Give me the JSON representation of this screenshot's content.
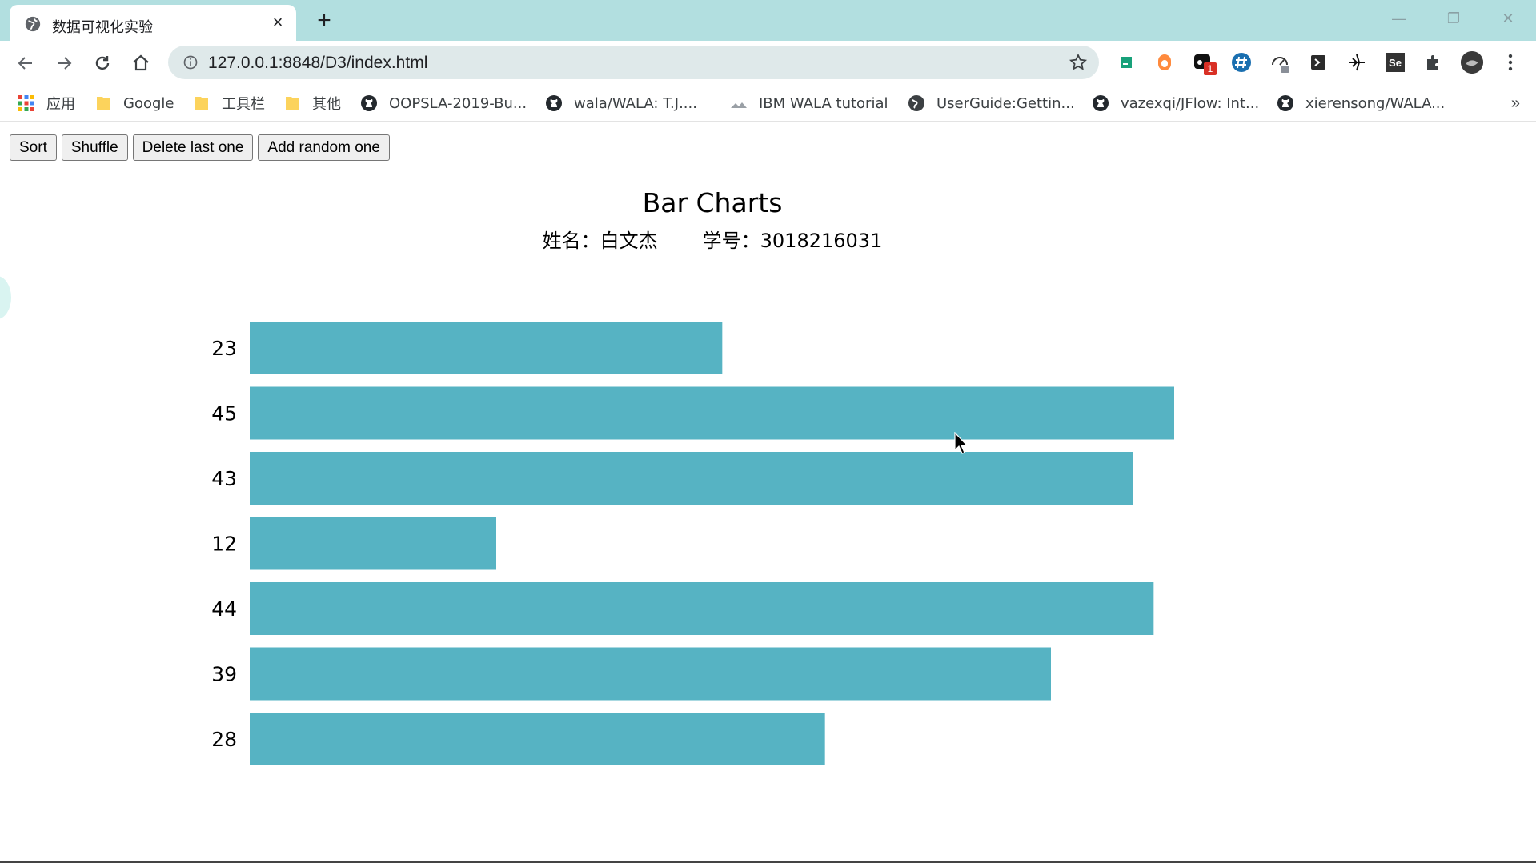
{
  "browser": {
    "tab": {
      "title": "数据可视化实验",
      "close_icon": "×"
    },
    "new_tab_label": "+",
    "window_controls": {
      "minimize": "—",
      "restore": "❐",
      "close": "✕"
    },
    "address": {
      "url": "127.0.0.1:8848/D3/index.html"
    },
    "extensions": [
      "jetbrains-icon",
      "firefox-style-icon",
      "notion-icon",
      "hash-icon",
      "speed-icon",
      "terminal-icon",
      "plane-icon",
      "selenium-icon",
      "puzzle-icon",
      "profile-avatar"
    ],
    "extension_badge": "1",
    "selenium_label": "Se",
    "bookmarks": [
      {
        "label": "应用",
        "icon": "apps-grid-icon"
      },
      {
        "label": "Google",
        "icon": "folder-icon"
      },
      {
        "label": "工具栏",
        "icon": "folder-icon"
      },
      {
        "label": "其他",
        "icon": "folder-icon"
      },
      {
        "label": "OOPSLA-2019-Bu...",
        "icon": "github-icon"
      },
      {
        "label": "wala/WALA: T.J....",
        "icon": "github-icon"
      },
      {
        "label": "IBM WALA tutorial",
        "icon": "mountain-icon"
      },
      {
        "label": "UserGuide:Gettin...",
        "icon": "globe-icon"
      },
      {
        "label": "vazexqi/JFlow: Int...",
        "icon": "github-icon"
      },
      {
        "label": "xierensong/WALA...",
        "icon": "github-icon"
      }
    ],
    "bookmarks_more": "»"
  },
  "controls": {
    "sort": "Sort",
    "shuffle": "Shuffle",
    "delete_last": "Delete last one",
    "add_random": "Add random one"
  },
  "heading": {
    "title": "Bar Charts",
    "name_label": "姓名：白文杰",
    "id_label": "学号：3018216031"
  },
  "colors": {
    "bar": "#56b3c3",
    "tab_strip": "#b2dfe0"
  },
  "chart_data": {
    "type": "bar",
    "orientation": "horizontal",
    "categories": [
      "23",
      "45",
      "43",
      "12",
      "44",
      "39",
      "28"
    ],
    "values": [
      23,
      45,
      43,
      12,
      44,
      39,
      28
    ],
    "title": "Bar Charts",
    "xlim": [
      0,
      45
    ]
  }
}
